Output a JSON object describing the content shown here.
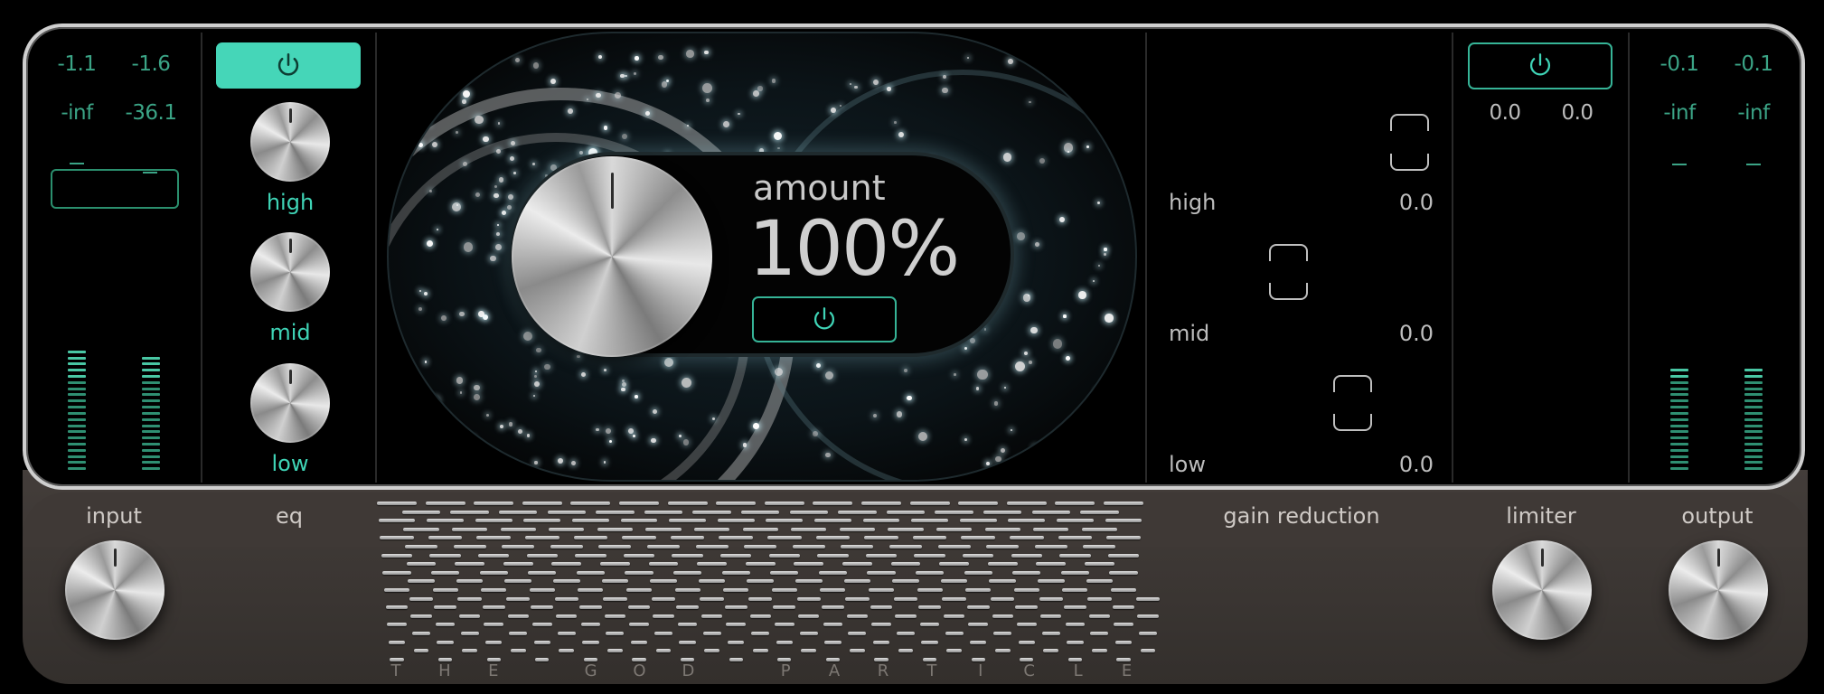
{
  "input": {
    "label": "input",
    "peak_left": "-1.1",
    "peak_right": "-1.6",
    "rms_left": "-inf",
    "rms_right": "-36.1",
    "meter_left_level": 0.62,
    "meter_right_level": 0.6
  },
  "eq": {
    "label": "eq",
    "power_on": true,
    "bands": [
      {
        "label": "high"
      },
      {
        "label": "mid"
      },
      {
        "label": "low"
      }
    ]
  },
  "amount": {
    "label": "amount",
    "value": "100%",
    "power_on": false
  },
  "gain_reduction": {
    "label": "gain reduction",
    "bands": [
      {
        "label": "high",
        "value": "0.0"
      },
      {
        "label": "mid",
        "value": "0.0"
      },
      {
        "label": "low",
        "value": "0.0"
      }
    ]
  },
  "limiter": {
    "label": "limiter",
    "power_on": false,
    "value_left": "0.0",
    "value_right": "0.0"
  },
  "output": {
    "label": "output",
    "peak_left": "-0.1",
    "peak_right": "-0.1",
    "rms_left": "-inf",
    "rms_right": "-inf",
    "meter_left_level": 0.52,
    "meter_right_level": 0.52
  },
  "brand": "THE GOD PARTICLE",
  "colors": {
    "accent": "#3fd4b6",
    "meter_text": "#3ba486",
    "panel_bg": "#000000",
    "chassis": "#3b3633"
  },
  "icons": {
    "power": "power-icon"
  }
}
